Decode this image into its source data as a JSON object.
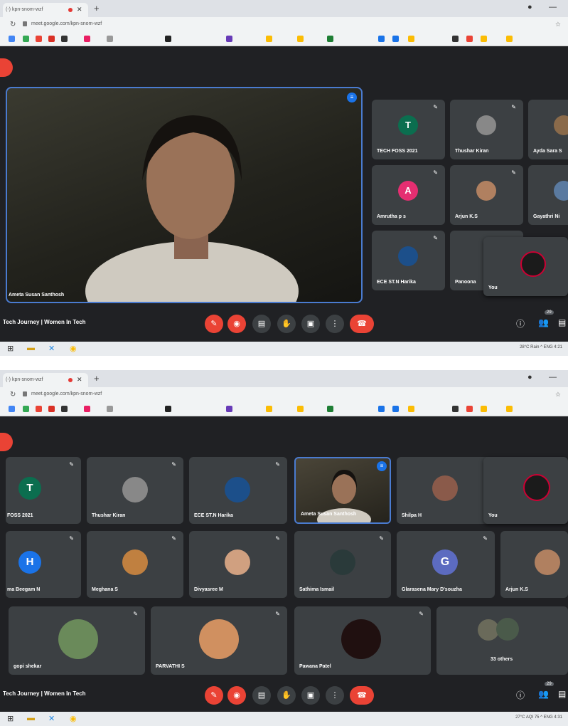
{
  "screens": [
    {
      "tab_title": "(-) kpn-snom-wzf",
      "url": "meet.google.com/kpn-snom-wzf",
      "main_speaker": "Ameta Susan Santhosh",
      "tiles": [
        {
          "name": "TECH FOSS 2021",
          "initial": "T",
          "color": "#0b6e4f"
        },
        {
          "name": "Thushar Kiran",
          "initial": "",
          "color": "#888888"
        },
        {
          "name": "Ayda Sara S",
          "initial": "",
          "color": "#8a6a4a"
        },
        {
          "name": "Amrutha p s",
          "initial": "A",
          "color": "#e52e71"
        },
        {
          "name": "Arjun K.S",
          "initial": "",
          "color": "#b08060"
        },
        {
          "name": "Gayathri Ni",
          "initial": "",
          "color": "#5a7aa0"
        },
        {
          "name": "ECE ST.N Harika",
          "initial": "",
          "color": "#1c4f8a"
        },
        {
          "name": "Panoona",
          "initial": "",
          "color": "#333333"
        }
      ],
      "self_tile": {
        "name": "You"
      },
      "meeting_title": "Tech Journey | Women In Tech",
      "participant_count": "29",
      "tray_text": "28°C Rain  ^  ENG  4:21"
    },
    {
      "tab_title": "(-) kpn-snom-wzf",
      "url": "meet.google.com/kpn-snom-wzf",
      "tiles": [
        {
          "name": "FOSS 2021",
          "initial": "T",
          "color": "#0b6e4f"
        },
        {
          "name": "Thushar Kiran",
          "initial": "",
          "color": "#888888"
        },
        {
          "name": "ECE ST.N Harika",
          "initial": "",
          "color": "#1c4f8a"
        },
        {
          "name": "Ameta Susan Santhosh",
          "initial": "",
          "color": "#5a4636"
        },
        {
          "name": "Shilpa H",
          "initial": "",
          "color": "#8a5a4a"
        },
        {
          "name": "You",
          "initial": "",
          "color": "#222222"
        },
        {
          "name": "ma Beegam N",
          "initial": "H",
          "color": "#1a73e8"
        },
        {
          "name": "Meghana S",
          "initial": "",
          "color": "#c08040"
        },
        {
          "name": "Divyasree M",
          "initial": "",
          "color": "#d0a080"
        },
        {
          "name": "Sathima Ismail",
          "initial": "",
          "color": "#2a3a3a"
        },
        {
          "name": "Glarasena Mary D'souzha",
          "initial": "G",
          "color": "#5c6bc0"
        },
        {
          "name": "Arjun K.S",
          "initial": "",
          "color": "#b08060"
        },
        {
          "name": "gopi shekar",
          "initial": "",
          "color": "#6a8a5a"
        },
        {
          "name": "PARVATHI S",
          "initial": "",
          "color": "#d09060"
        },
        {
          "name": "Pawana Patel",
          "initial": "",
          "color": "#201010"
        },
        {
          "name": "33 others",
          "initial": "",
          "color": "#6a6a5a"
        }
      ],
      "meeting_title": "Tech Journey | Women In Tech",
      "participant_count": "29",
      "tray_text": "27°C AQI 75  ^  ENG  4:31"
    }
  ]
}
